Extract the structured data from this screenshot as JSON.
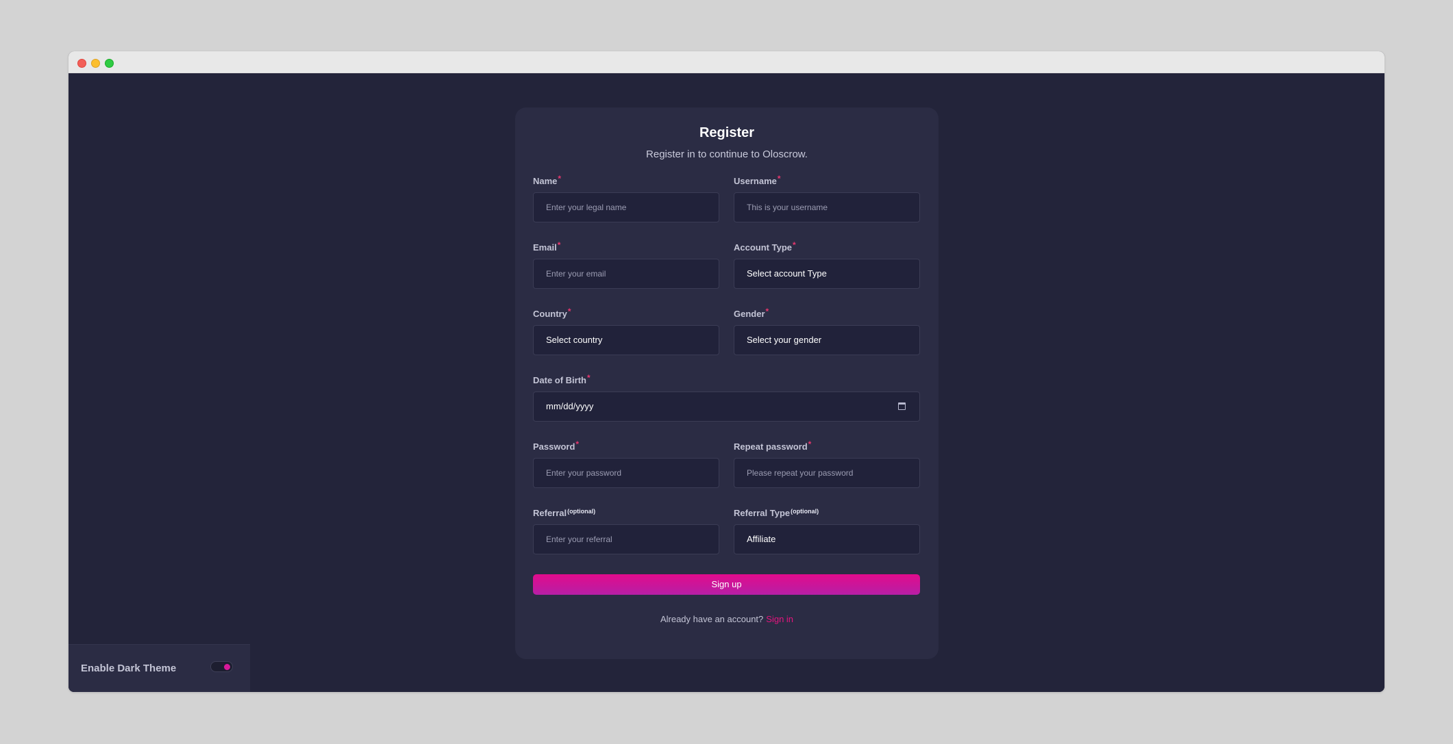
{
  "window": {
    "controls": [
      "close",
      "minimize",
      "maximize"
    ]
  },
  "form": {
    "title": "Register",
    "subtitle": "Register in to continue to Oloscrow.",
    "required_mark": "*",
    "optional_mark": "(optional)",
    "fields": {
      "name": {
        "label": "Name",
        "placeholder": "Enter your legal name"
      },
      "username": {
        "label": "Username",
        "placeholder": "This is your username"
      },
      "email": {
        "label": "Email",
        "placeholder": "Enter your email"
      },
      "account_type": {
        "label": "Account Type",
        "value": "Select account Type"
      },
      "country": {
        "label": "Country",
        "value": "Select country"
      },
      "gender": {
        "label": "Gender",
        "value": "Select your gender"
      },
      "dob": {
        "label": "Date of Birth",
        "value": "mm/dd/yyyy"
      },
      "password": {
        "label": "Password",
        "placeholder": "Enter your password"
      },
      "repeat_password": {
        "label": "Repeat password",
        "placeholder": "Please repeat your password"
      },
      "referral": {
        "label": "Referral",
        "placeholder": "Enter your referral"
      },
      "referral_type": {
        "label": "Referral Type",
        "value": "Affiliate"
      }
    },
    "submit_label": "Sign up",
    "signin_prompt": "Already have an account?",
    "signin_link": "Sign in"
  },
  "theme_toggle": {
    "label": "Enable Dark Theme",
    "enabled": true
  },
  "colors": {
    "background": "#23243a",
    "card": "#2b2c44",
    "accent": "#e10b8c",
    "required": "#e8376e"
  }
}
